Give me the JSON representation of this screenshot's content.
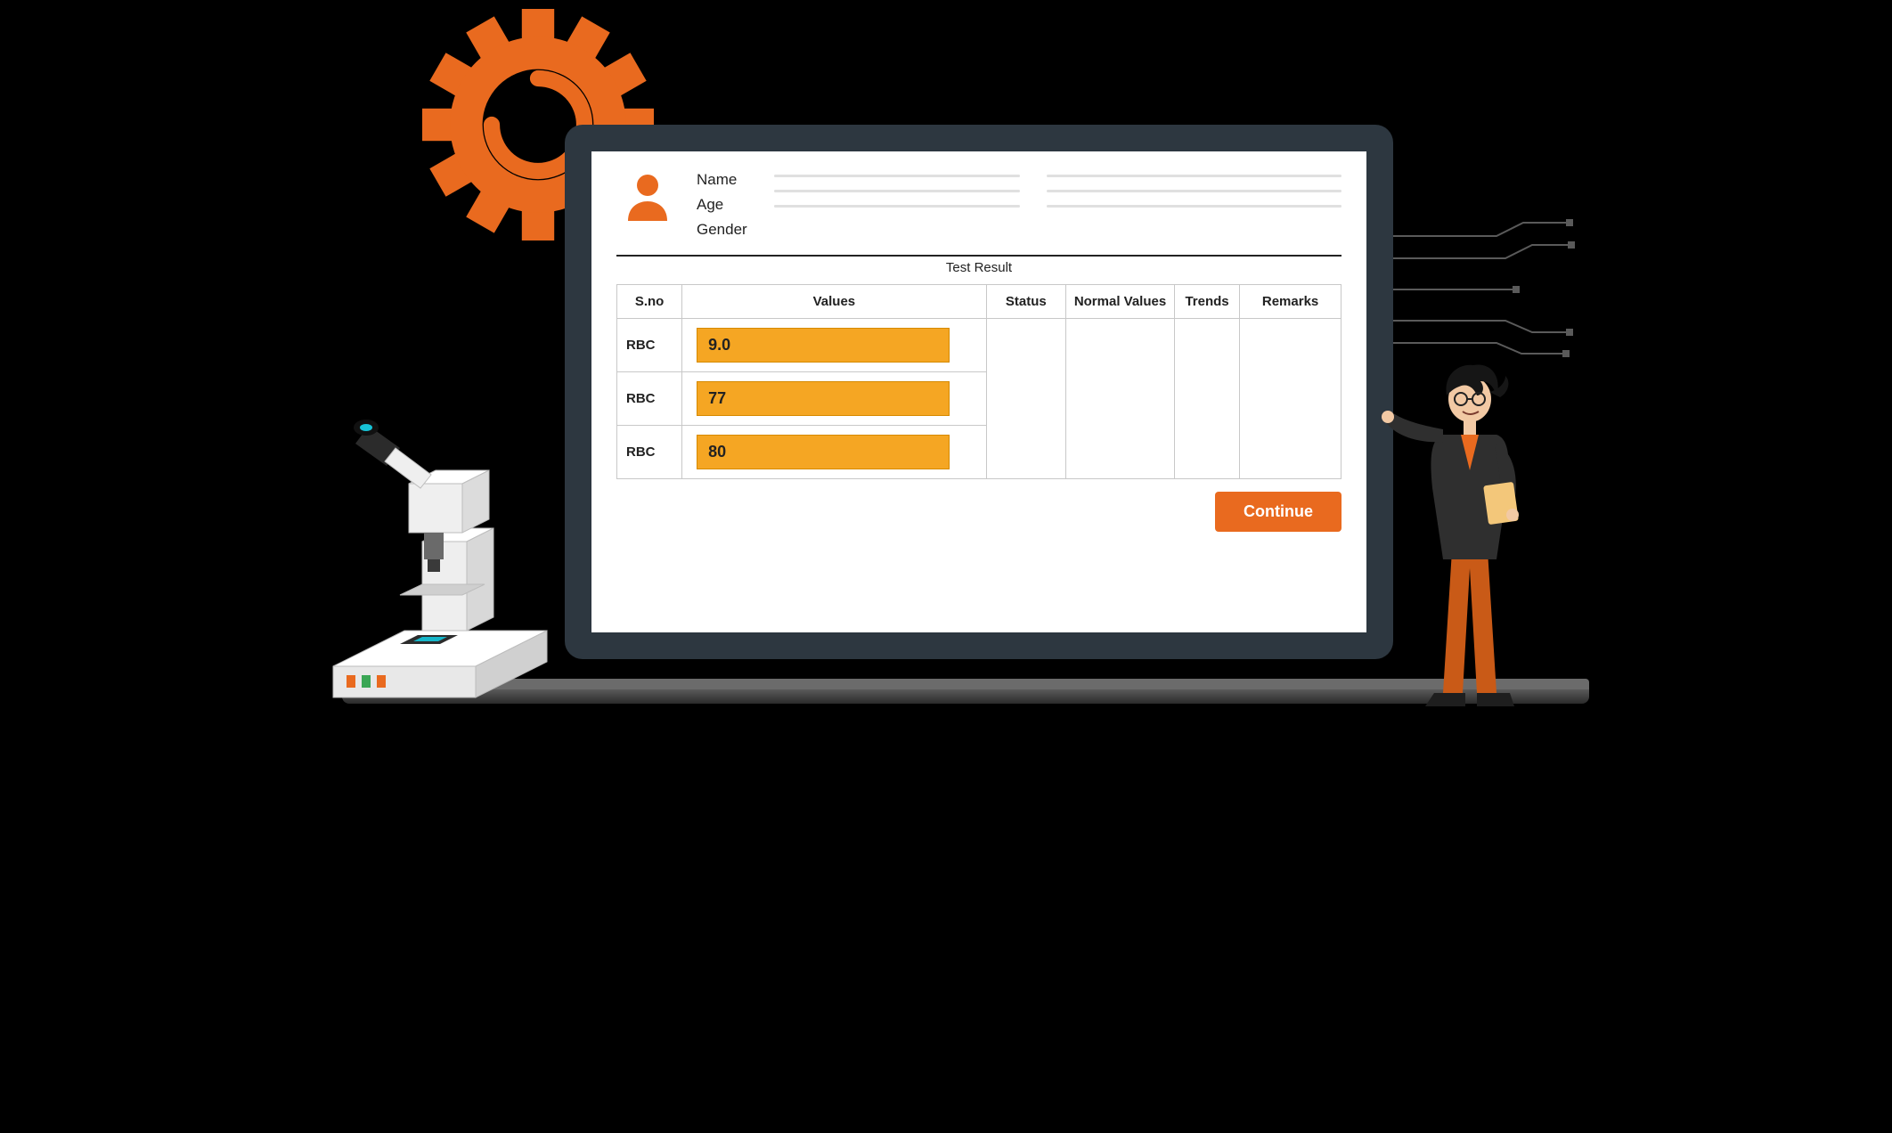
{
  "colors": {
    "accent": "#e96a1f",
    "bar": "#f5a623",
    "bezel": "#2d3740"
  },
  "patient": {
    "labels": {
      "name": "Name",
      "age": "Age",
      "gender": "Gender"
    },
    "values": {
      "name": "",
      "age": "",
      "gender": ""
    }
  },
  "section_title": "Test Result",
  "table": {
    "headers": {
      "sno": "S.no",
      "values": "Values",
      "status": "Status",
      "normal_values": "Normal Values",
      "trends": "Trends",
      "remarks": "Remarks"
    },
    "rows": [
      {
        "sno": "RBC",
        "value": "9.0",
        "status": "",
        "normal": "",
        "trends": "",
        "remarks": ""
      },
      {
        "sno": "RBC",
        "value": "77",
        "status": "",
        "normal": "",
        "trends": "",
        "remarks": ""
      },
      {
        "sno": "RBC",
        "value": "80",
        "status": "",
        "normal": "",
        "trends": "",
        "remarks": ""
      }
    ]
  },
  "actions": {
    "continue": "Continue"
  },
  "icons": {
    "gear": "gear-icon",
    "avatar": "person-icon",
    "microscope": "microscope-icon",
    "traces": "circuit-traces-icon",
    "presenter": "presenter-person-icon"
  }
}
